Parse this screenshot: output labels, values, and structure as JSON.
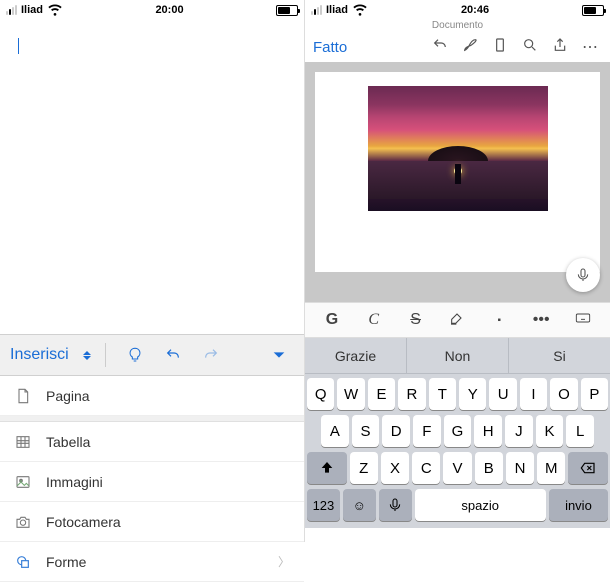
{
  "left": {
    "status": {
      "carrier": "Iliad",
      "time": "20:00"
    },
    "toolbar": {
      "label": "Inserisci"
    },
    "menu": [
      {
        "icon": "page-icon",
        "label": "Pagina"
      },
      {
        "icon": "table-icon",
        "label": "Tabella"
      },
      {
        "icon": "image-icon",
        "label": "Immagini"
      },
      {
        "icon": "camera-icon",
        "label": "Fotocamera"
      },
      {
        "icon": "shapes-icon",
        "label": "Forme"
      }
    ]
  },
  "right": {
    "status": {
      "carrier": "Iliad",
      "time": "20:46"
    },
    "docname": "Documento",
    "done": "Fatto",
    "format": {
      "bold": "G",
      "italic": "C",
      "strike": "S"
    },
    "suggestions": [
      "Grazie",
      "Non",
      "Si"
    ],
    "keys": {
      "row1": [
        "Q",
        "W",
        "E",
        "R",
        "T",
        "Y",
        "U",
        "I",
        "O",
        "P"
      ],
      "row2": [
        "A",
        "S",
        "D",
        "F",
        "G",
        "H",
        "J",
        "K",
        "L"
      ],
      "row3": [
        "Z",
        "X",
        "C",
        "V",
        "B",
        "N",
        "M"
      ],
      "numkey": "123",
      "space": "spazio",
      "enter": "invio"
    }
  }
}
